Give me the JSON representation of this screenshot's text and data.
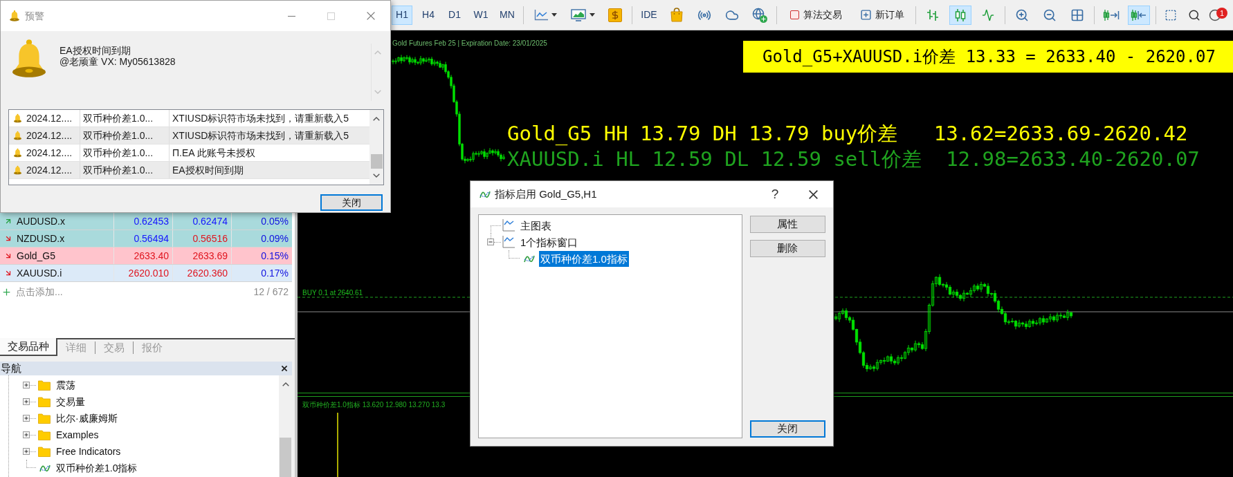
{
  "alert_dialog": {
    "title": "预警",
    "message": [
      "EA授权时间到期",
      "@老顽童 VX: My05613828"
    ],
    "log": [
      {
        "time": "2024.12....",
        "source": "双币种价差1.0...",
        "message": "XTIUSD标识符市场未找到，请重新载入5"
      },
      {
        "time": "2024.12....",
        "source": "双币种价差1.0...",
        "message": "XTIUSD标识符市场未找到，请重新载入5"
      },
      {
        "time": "2024.12....",
        "source": "双币种价差1.0...",
        "message": "П.EA 此账号未授权"
      },
      {
        "time": "2024.12....",
        "source": "双币种价差1.0...",
        "message": "EA授权时间到期"
      }
    ],
    "close_button": {
      "label": "关闭",
      "default": true
    }
  },
  "toolbar": {
    "timeframes": [
      {
        "label": "H1",
        "selected": true
      },
      {
        "label": "H4",
        "selected": false
      },
      {
        "label": "D1",
        "selected": false
      },
      {
        "label": "W1",
        "selected": false
      },
      {
        "label": "MN",
        "selected": false
      }
    ],
    "ide_button": "IDE",
    "algo_trading_button": "算法交易",
    "new_order_button": "新订单",
    "chart_types": [
      {
        "kind": "bars",
        "selected": false
      },
      {
        "kind": "candles",
        "selected": true
      },
      {
        "kind": "line",
        "selected": false
      }
    ],
    "chart_toggles": [
      {
        "kind": "shift",
        "selected": false
      },
      {
        "kind": "autoscroll",
        "selected": true
      }
    ],
    "notification_count": "1"
  },
  "market_watch": {
    "rows": [
      {
        "symbol": "AUDUSD.x",
        "rising": true,
        "color": "#a9dadc",
        "bid": "0.62453",
        "bid_rising": true,
        "ask": "0.62474",
        "ask_rising": true,
        "change": "0.05%"
      },
      {
        "symbol": "NZDUSD.x",
        "rising": false,
        "color": "#a9dadc",
        "bid": "0.56494",
        "bid_rising": true,
        "ask": "0.56516",
        "ask_rising": false,
        "change": "0.09%"
      },
      {
        "symbol": "Gold_G5",
        "rising": false,
        "color": "#ffc4cc",
        "bid": "2633.40",
        "bid_rising": false,
        "ask": "2633.69",
        "ask_rising": false,
        "change": "0.15%"
      },
      {
        "symbol": "XAUUSD.i",
        "rising": false,
        "color": "#dceaf8",
        "bid": "2620.010",
        "bid_rising": false,
        "ask": "2620.360",
        "ask_rising": false,
        "change": "0.17%"
      }
    ],
    "add_symbol": "点击添加...",
    "symbol_count": "12 / 672"
  },
  "panel_tabs": [
    {
      "label": "交易品种",
      "selected": true
    },
    {
      "label": "详细",
      "selected": false
    },
    {
      "label": "交易",
      "selected": false
    },
    {
      "label": "报价",
      "selected": false
    }
  ],
  "navigator": {
    "title": "导航",
    "items": [
      {
        "kind": "folder",
        "label": "震荡",
        "expanded": false
      },
      {
        "kind": "folder",
        "label": "交易量",
        "expanded": false
      },
      {
        "kind": "folder",
        "label": "比尔·威廉姆斯",
        "expanded": false
      },
      {
        "kind": "folder",
        "label": "Examples",
        "expanded": false
      },
      {
        "kind": "folder",
        "label": "Free Indicators",
        "expanded": false
      },
      {
        "kind": "indicator",
        "label": "双币种价差1.0指标"
      }
    ]
  },
  "chart": {
    "contract_info": "Gold Futures Feb 25 | Expiration Date: 23/01/2025",
    "spread_banner": "Gold_G5+XAUUSD.i价差 13.33 = 2633.40 - 2620.07",
    "info_lines": [
      {
        "text": "Gold_G5 HH 13.79 DH 13.79 buy价差   13.62=2633.69-2620.42",
        "color": "#ffff00"
      },
      {
        "text": "XAUUSD.i HL 12.59 DL 12.59 sell价差  12.98=2633.40-2620.07",
        "color": "#1fa31f"
      }
    ],
    "order_line_label": "BUY 0.1 at 2640.61",
    "indicator_label": "双币种价差1.0指标 13.620 12.980 13.270 13.3"
  },
  "indicator_dialog": {
    "title": "指标启用 Gold_G5,H1",
    "help_button": "?",
    "tree": [
      {
        "kind": "window",
        "label": "主图表",
        "selected": false
      },
      {
        "kind": "window",
        "label": "1个指标窗口",
        "selected": false,
        "expanded": true,
        "children": [
          {
            "kind": "indicator",
            "label": "双币种价差1.0指标",
            "selected": true
          }
        ]
      }
    ],
    "side_buttons": [
      {
        "label": "属性"
      },
      {
        "label": "删除"
      }
    ],
    "close_button": {
      "label": "关闭",
      "default": true
    }
  }
}
